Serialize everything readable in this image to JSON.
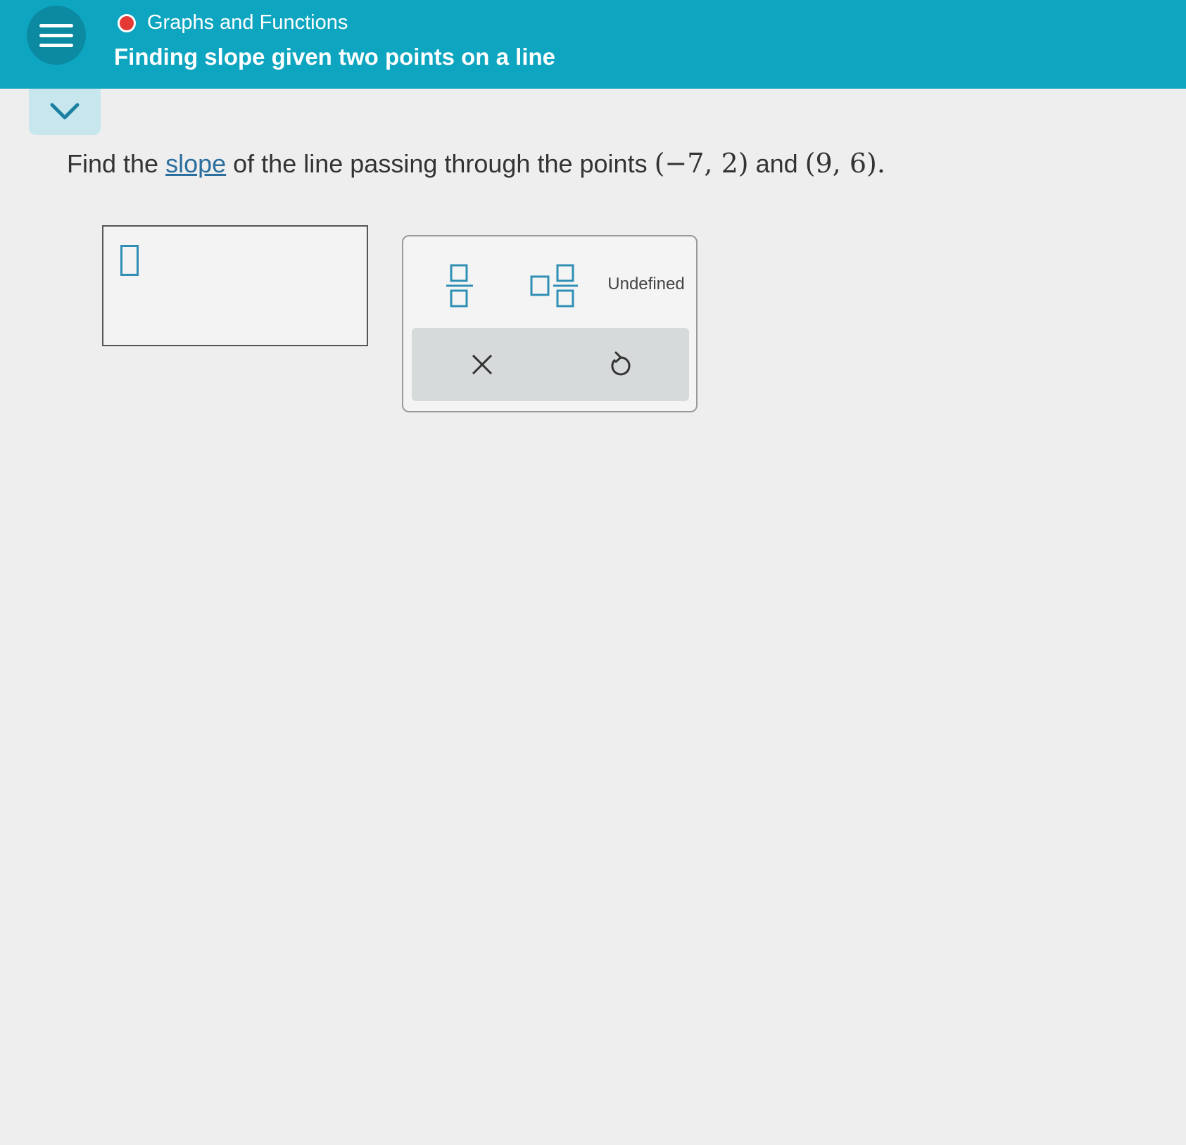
{
  "header": {
    "topic": "Graphs and Functions",
    "lesson_title": "Finding slope given two points on a line",
    "menu_icon": "hamburger-menu-icon",
    "status_icon": "red-dot-icon"
  },
  "collapse": {
    "icon": "chevron-down-icon"
  },
  "question": {
    "prefix": "Find the ",
    "link_text": "slope",
    "middle": " of the line passing through the points ",
    "point1": "(−7, 2)",
    "conjunction": " and ",
    "point2": "(9, 6)",
    "suffix": "."
  },
  "keypad": {
    "fraction_icon": "fraction-template-icon",
    "mixed_number_icon": "mixed-number-template-icon",
    "undefined_label": "Undefined",
    "clear_icon": "x-icon",
    "undo_icon": "undo-icon"
  },
  "colors": {
    "header_bg": "#0ea5c0",
    "accent_blue": "#2f8fb5",
    "status_red": "#e53935",
    "link_blue": "#2b6f9e"
  }
}
